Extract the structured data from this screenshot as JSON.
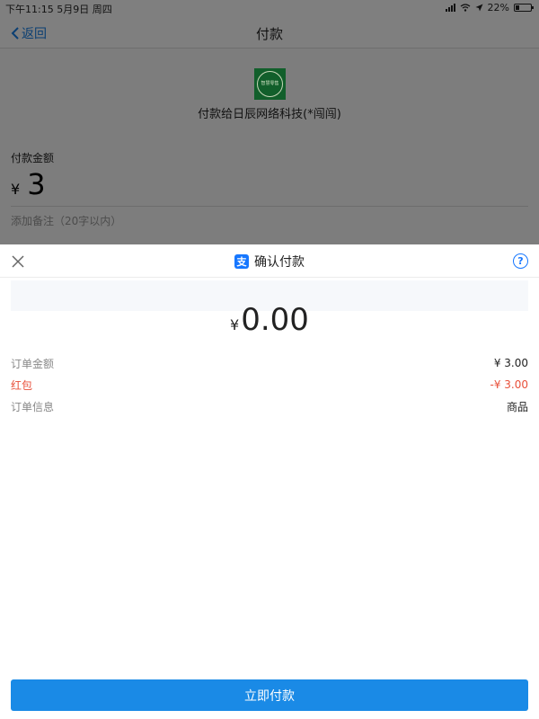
{
  "status_bar": {
    "time_date": "下午11:15  5月9日 周四",
    "battery": "22%",
    "battery_level": 0.22
  },
  "nav": {
    "back_label": "返回",
    "title": "付款"
  },
  "background_page": {
    "merchant_logo_text": "智慧零售",
    "merchant_name": "付款给日辰网络科技(*闯闯)",
    "amount_label": "付款金额",
    "currency": "¥",
    "amount": "3",
    "remark_placeholder": "添加备注（20字以内）"
  },
  "sheet": {
    "title": "确认付款",
    "alipay_icon_glyph": "支",
    "help_glyph": "?",
    "total_currency": "¥",
    "total_amount": "0.00",
    "rows": [
      {
        "label": "订单金额",
        "value": "¥ 3.00"
      },
      {
        "label": "红包",
        "value": "-¥ 3.00"
      },
      {
        "label": "订单信息",
        "value": "商品"
      }
    ],
    "pay_button_label": "立即付款"
  },
  "colors": {
    "accent": "#1a8ae6",
    "discount_red": "#e8503a",
    "dim_overlay": "#7d7d7d"
  }
}
